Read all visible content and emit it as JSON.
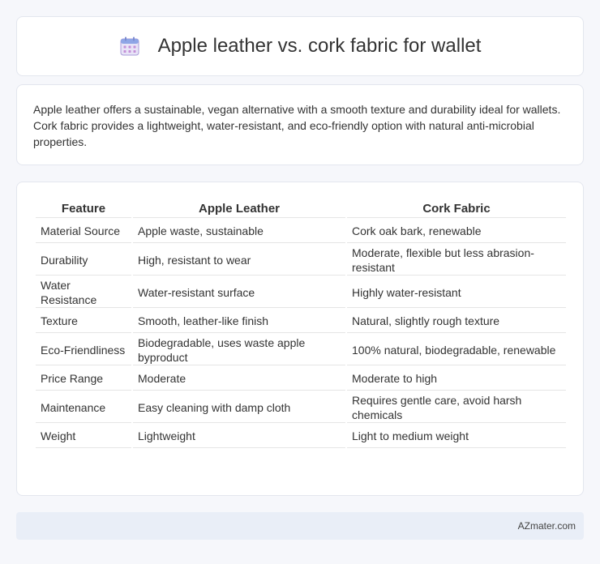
{
  "header": {
    "title": "Apple leather vs. cork fabric for wallet",
    "icon": "calendar-icon"
  },
  "intro": {
    "text": "Apple leather offers a sustainable, vegan alternative with a smooth texture and durability ideal for wallets. Cork fabric provides a lightweight, water-resistant, and eco-friendly option with natural anti-microbial properties."
  },
  "table": {
    "headers": [
      "Feature",
      "Apple Leather",
      "Cork Fabric"
    ],
    "rows": [
      {
        "feature": "Material Source",
        "apple": "Apple waste, sustainable",
        "cork": "Cork oak bark, renewable"
      },
      {
        "feature": "Durability",
        "apple": "High, resistant to wear",
        "cork": "Moderate, flexible but less abrasion-resistant"
      },
      {
        "feature": "Water Resistance",
        "apple": "Water-resistant surface",
        "cork": "Highly water-resistant"
      },
      {
        "feature": "Texture",
        "apple": "Smooth, leather-like finish",
        "cork": "Natural, slightly rough texture"
      },
      {
        "feature": "Eco-Friendliness",
        "apple": "Biodegradable, uses waste apple byproduct",
        "cork": "100% natural, biodegradable, renewable"
      },
      {
        "feature": "Price Range",
        "apple": "Moderate",
        "cork": "Moderate to high"
      },
      {
        "feature": "Maintenance",
        "apple": "Easy cleaning with damp cloth",
        "cork": "Requires gentle care, avoid harsh chemicals"
      },
      {
        "feature": "Weight",
        "apple": "Lightweight",
        "cork": "Light to medium weight"
      }
    ]
  },
  "footer": {
    "brand": "AZmater.com"
  }
}
